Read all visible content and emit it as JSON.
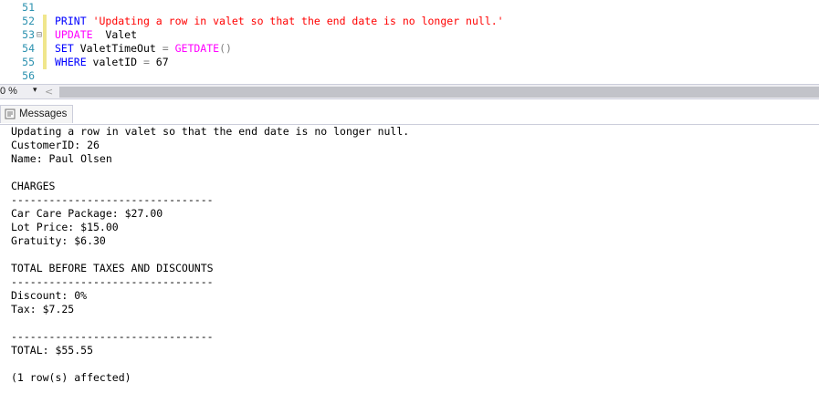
{
  "editor": {
    "lines": [
      {
        "n": "51",
        "fold": "",
        "changed": false,
        "tokens": []
      },
      {
        "n": "52",
        "fold": "",
        "changed": true,
        "tokens": [
          {
            "t": "kw",
            "v": "PRINT"
          },
          {
            "t": "tx",
            "v": " "
          },
          {
            "t": "str",
            "v": "'Updating a row in valet so that the end date is no longer null.'"
          }
        ]
      },
      {
        "n": "53",
        "fold": "⊟",
        "changed": true,
        "tokens": [
          {
            "t": "fn",
            "v": "UPDATE"
          },
          {
            "t": "tx",
            "v": "  Valet"
          }
        ]
      },
      {
        "n": "54",
        "fold": "",
        "changed": true,
        "tokens": [
          {
            "t": "kw",
            "v": "SET"
          },
          {
            "t": "tx",
            "v": " ValetTimeOut "
          },
          {
            "t": "op",
            "v": "="
          },
          {
            "t": "tx",
            "v": " "
          },
          {
            "t": "fn",
            "v": "GETDATE"
          },
          {
            "t": "op",
            "v": "()"
          }
        ]
      },
      {
        "n": "55",
        "fold": "",
        "changed": true,
        "tokens": [
          {
            "t": "kw",
            "v": "WHERE"
          },
          {
            "t": "tx",
            "v": " valetID "
          },
          {
            "t": "op",
            "v": "="
          },
          {
            "t": "tx",
            "v": " 67"
          }
        ]
      },
      {
        "n": "56",
        "fold": "",
        "changed": false,
        "tokens": []
      }
    ]
  },
  "statusbar": {
    "zoom": "0 %",
    "zoom_arrow": "▾",
    "scroll_left": "<"
  },
  "results_tabs": {
    "messages_label": "Messages"
  },
  "messages": [
    "Updating a row in valet so that the end date is no longer null.",
    "CustomerID: 26",
    "Name: Paul Olsen",
    "",
    "CHARGES",
    "--------------------------------",
    "Car Care Package: $27.00",
    "Lot Price: $15.00",
    "Gratuity: $6.30",
    "",
    "TOTAL BEFORE TAXES AND DISCOUNTS",
    "--------------------------------",
    "Discount: 0%",
    "Tax: $7.25",
    "",
    "--------------------------------",
    "TOTAL: $55.55",
    "",
    "(1 row(s) affected)"
  ]
}
